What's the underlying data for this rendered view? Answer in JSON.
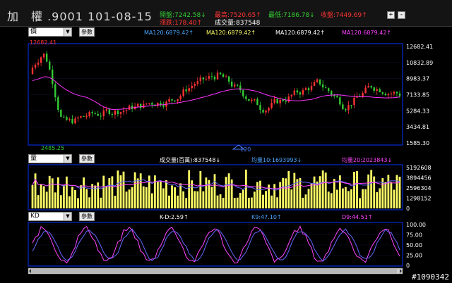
{
  "header": {
    "title": "加　權 .9001 101-08-15",
    "open": "開盤:7242.58↓",
    "high": "最高:7520.65↑",
    "low": "最低:7186.78↓",
    "close": "收盤:7449.69↑",
    "change": "漲跌:178.40↑",
    "volume": "成交量:837548",
    "btn_plus": "+",
    "btn_minus": "-"
  },
  "price_panel": {
    "selector": "價",
    "param_btn": "參數",
    "ma_labels": [
      "MA120:6879.42↑",
      "MA120:6879.42↑",
      "MA120:6879.42↑",
      "MA120:6879.42↑"
    ],
    "ma_colors": [
      "#4da6ff",
      "#ffff66",
      "#ffffff",
      "#ff44ff"
    ],
    "high_mark": "12682.41",
    "low_mark": "2485.25",
    "y_ticks": [
      "12682.41",
      "10832.89",
      "8983.37",
      "7133.85",
      "5284.33",
      "3434.81",
      "1585.30"
    ],
    "scroll_label": "120"
  },
  "volume_panel": {
    "selector": "量",
    "param_btn": "參數",
    "vol_label": "成交量(百萬):837548↓",
    "avg10_label": "均量10:1693993↓",
    "avg20_label": "均量20:2023843↓",
    "y_ticks": [
      "5192608",
      "3894456",
      "2596304",
      "1298152",
      "0"
    ]
  },
  "kd_panel": {
    "selector": "KD",
    "param_btn": "參數",
    "kd_label": "K-D:2.59↑",
    "k_label": "K9:47.10↑",
    "d_label": "D9:44.51↑",
    "y_ticks": [
      "100.00",
      "75.00",
      "50.00",
      "25.00",
      "0"
    ]
  },
  "colors": {
    "up_candle": "#ff3333",
    "down_candle": "#33cc33",
    "ma_line": "#ff33ff",
    "volume_bar": "#ffff66",
    "k_line": "#ff44ff",
    "d_line": "#6666ff",
    "axis": "#0033ff"
  },
  "watermark": "#1090342"
}
